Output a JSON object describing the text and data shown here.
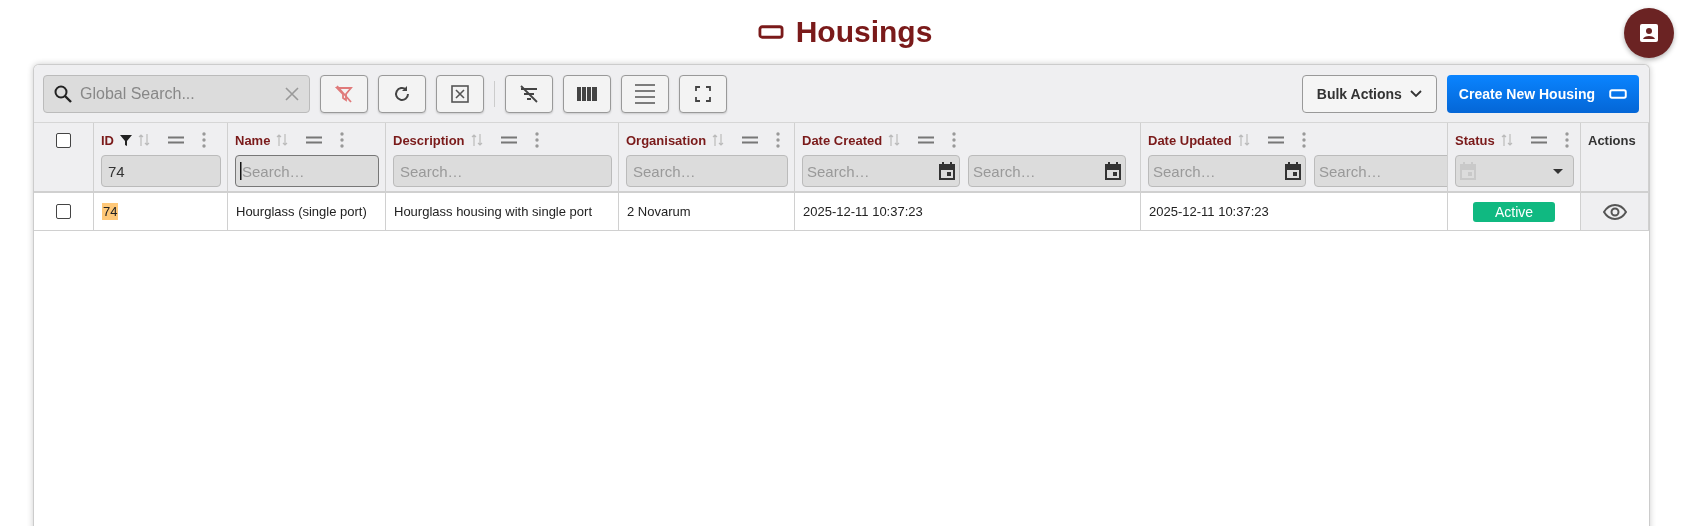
{
  "title": "Housings",
  "toolbar": {
    "search": {
      "placeholder": "Global Search..."
    },
    "bulk_actions": "Bulk Actions",
    "create_button": "Create New Housing"
  },
  "select_all": {
    "checked": false
  },
  "columns": [
    {
      "label": "ID",
      "kind": "text",
      "filtered": true,
      "filter": {
        "value": "74",
        "focused": false
      }
    },
    {
      "label": "Name",
      "kind": "text",
      "filtered": false,
      "filter": {
        "placeholder": "Search…",
        "focused": true
      }
    },
    {
      "label": "Description",
      "kind": "text",
      "filtered": false,
      "filter": {
        "placeholder": "Search…",
        "focused": false
      }
    },
    {
      "label": "Organisation",
      "kind": "text",
      "filtered": false,
      "filter": {
        "placeholder": "Search…",
        "focused": false
      }
    },
    {
      "label": "Date Created",
      "kind": "date",
      "filtered": false,
      "filters": [
        {
          "placeholder": "Search…"
        },
        {
          "placeholder": "Search…"
        }
      ]
    },
    {
      "label": "Date Updated",
      "kind": "date",
      "filtered": false,
      "filters": [
        {
          "placeholder": "Search…"
        },
        {
          "placeholder": "Search…"
        }
      ]
    },
    {
      "label": "Status",
      "kind": "select",
      "filtered": false
    },
    {
      "label": "Actions",
      "kind": "actions",
      "filtered": false
    }
  ],
  "rows": [
    {
      "checked": false,
      "cells": [
        {
          "kind": "match",
          "text": "74"
        },
        {
          "kind": "text",
          "text": "Hourglass (single port)"
        },
        {
          "kind": "text",
          "text": "Hourglass housing with single port"
        },
        {
          "kind": "text",
          "text": "2 Novarum"
        },
        {
          "kind": "text",
          "text": "2025-12-11 10:37:23"
        },
        {
          "kind": "text",
          "text": "2025-12-11 10:37:23"
        },
        {
          "kind": "status",
          "text": "Active",
          "color": "#10b981"
        },
        {
          "kind": "view"
        }
      ]
    }
  ]
}
